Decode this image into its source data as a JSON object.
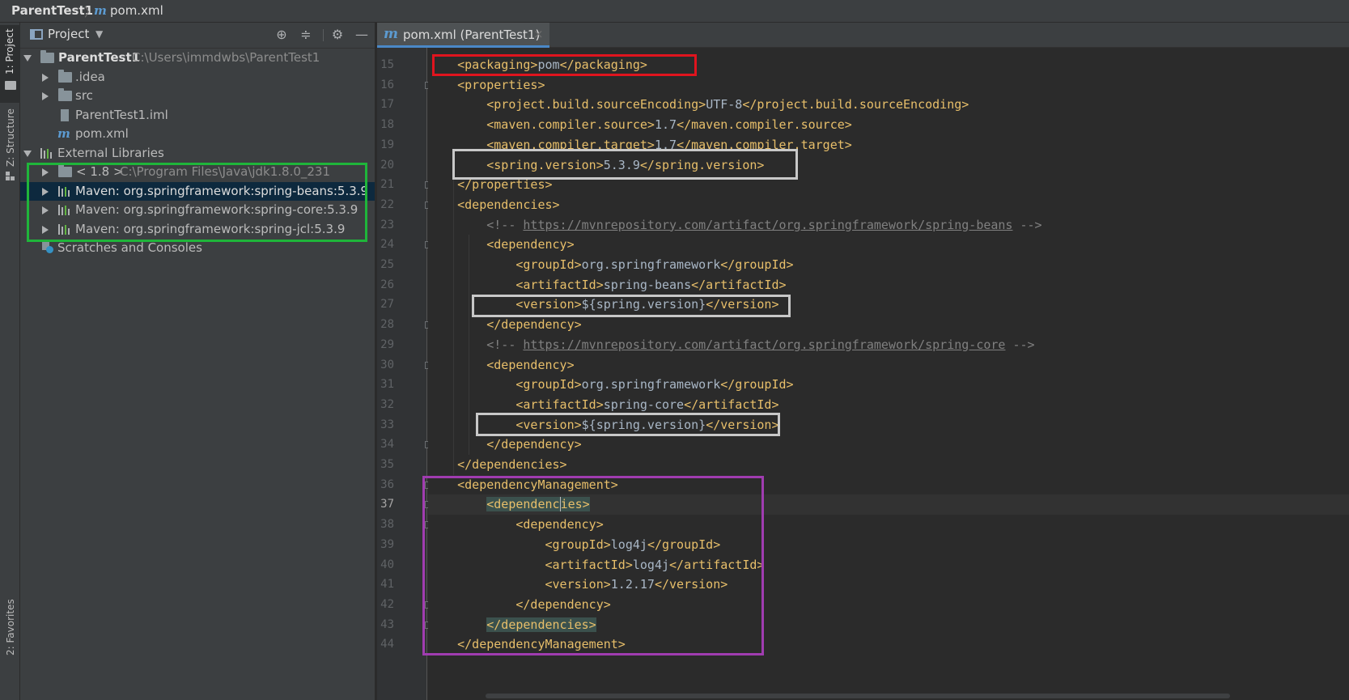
{
  "breadcrumb": {
    "project": "ParentTest1",
    "file_icon": "m",
    "file": "pom.xml"
  },
  "left_strip": {
    "project_tab": "1: Project",
    "structure_tab": "Z: Structure",
    "favorites_tab": "2: Favorites"
  },
  "project_panel": {
    "title": "Project",
    "icons": [
      "locate-icon",
      "collapse-all-icon",
      "gear-icon",
      "minimize-icon"
    ],
    "tree": [
      {
        "label": "ParentTest1",
        "path": "C:\\Users\\immdwbs\\ParentTest1"
      },
      {
        "label": ".idea"
      },
      {
        "label": "src"
      },
      {
        "label": "ParentTest1.iml"
      },
      {
        "label": "pom.xml",
        "icon": "m"
      },
      {
        "label": "External Libraries"
      },
      {
        "label": "< 1.8 >",
        "path": "C:\\Program Files\\Java\\jdk1.8.0_231"
      },
      {
        "label": "Maven: org.springframework:spring-beans:5.3.9"
      },
      {
        "label": "Maven: org.springframework:spring-core:5.3.9"
      },
      {
        "label": "Maven: org.springframework:spring-jcl:5.3.9"
      },
      {
        "label": "Scratches and Consoles"
      }
    ]
  },
  "editor_tab": {
    "icon": "m",
    "label": "pom.xml (ParentTest1)",
    "close": "×"
  },
  "code": {
    "line_numbers": [
      "15",
      "16",
      "17",
      "18",
      "19",
      "20",
      "21",
      "22",
      "23",
      "24",
      "25",
      "26",
      "27",
      "28",
      "29",
      "30",
      "31",
      "32",
      "33",
      "34",
      "35",
      "36",
      "37",
      "38",
      "39",
      "40",
      "41",
      "42",
      "43",
      "44"
    ],
    "lines": [
      "    <packaging>pom</packaging>",
      "    <properties>",
      "        <project.build.sourceEncoding>UTF-8</project.build.sourceEncoding>",
      "        <maven.compiler.source>1.7</maven.compiler.source>",
      "        <maven.compiler.target>1.7</maven.compiler.target>",
      "        <spring.version>5.3.9</spring.version>",
      "    </properties>",
      "    <dependencies>",
      "        <!-- https://mvnrepository.com/artifact/org.springframework/spring-beans -->",
      "        <dependency>",
      "            <groupId>org.springframework</groupId>",
      "            <artifactId>spring-beans</artifactId>",
      "            <version>${spring.version}</version>",
      "        </dependency>",
      "        <!-- https://mvnrepository.com/artifact/org.springframework/spring-core -->",
      "        <dependency>",
      "            <groupId>org.springframework</groupId>",
      "            <artifactId>spring-core</artifactId>",
      "            <version>${spring.version}</version>",
      "        </dependency>",
      "    </dependencies>",
      "    <dependencyManagement>",
      "        <dependencies>",
      "            <dependency>",
      "                <groupId>log4j</groupId>",
      "                <artifactId>log4j</artifactId>",
      "                <version>1.2.17</version>",
      "            </dependency>",
      "        </dependencies>",
      "    </dependencyManagement>"
    ],
    "current_line": "37"
  },
  "colors": {
    "tag": "#e8bf6a",
    "text": "#a9b7c6",
    "comment": "#808080",
    "annotation_red": "#e0141e",
    "annotation_white": "#c8c8c8",
    "annotation_green": "#1fb53a",
    "annotation_purple": "#a03cb0"
  }
}
